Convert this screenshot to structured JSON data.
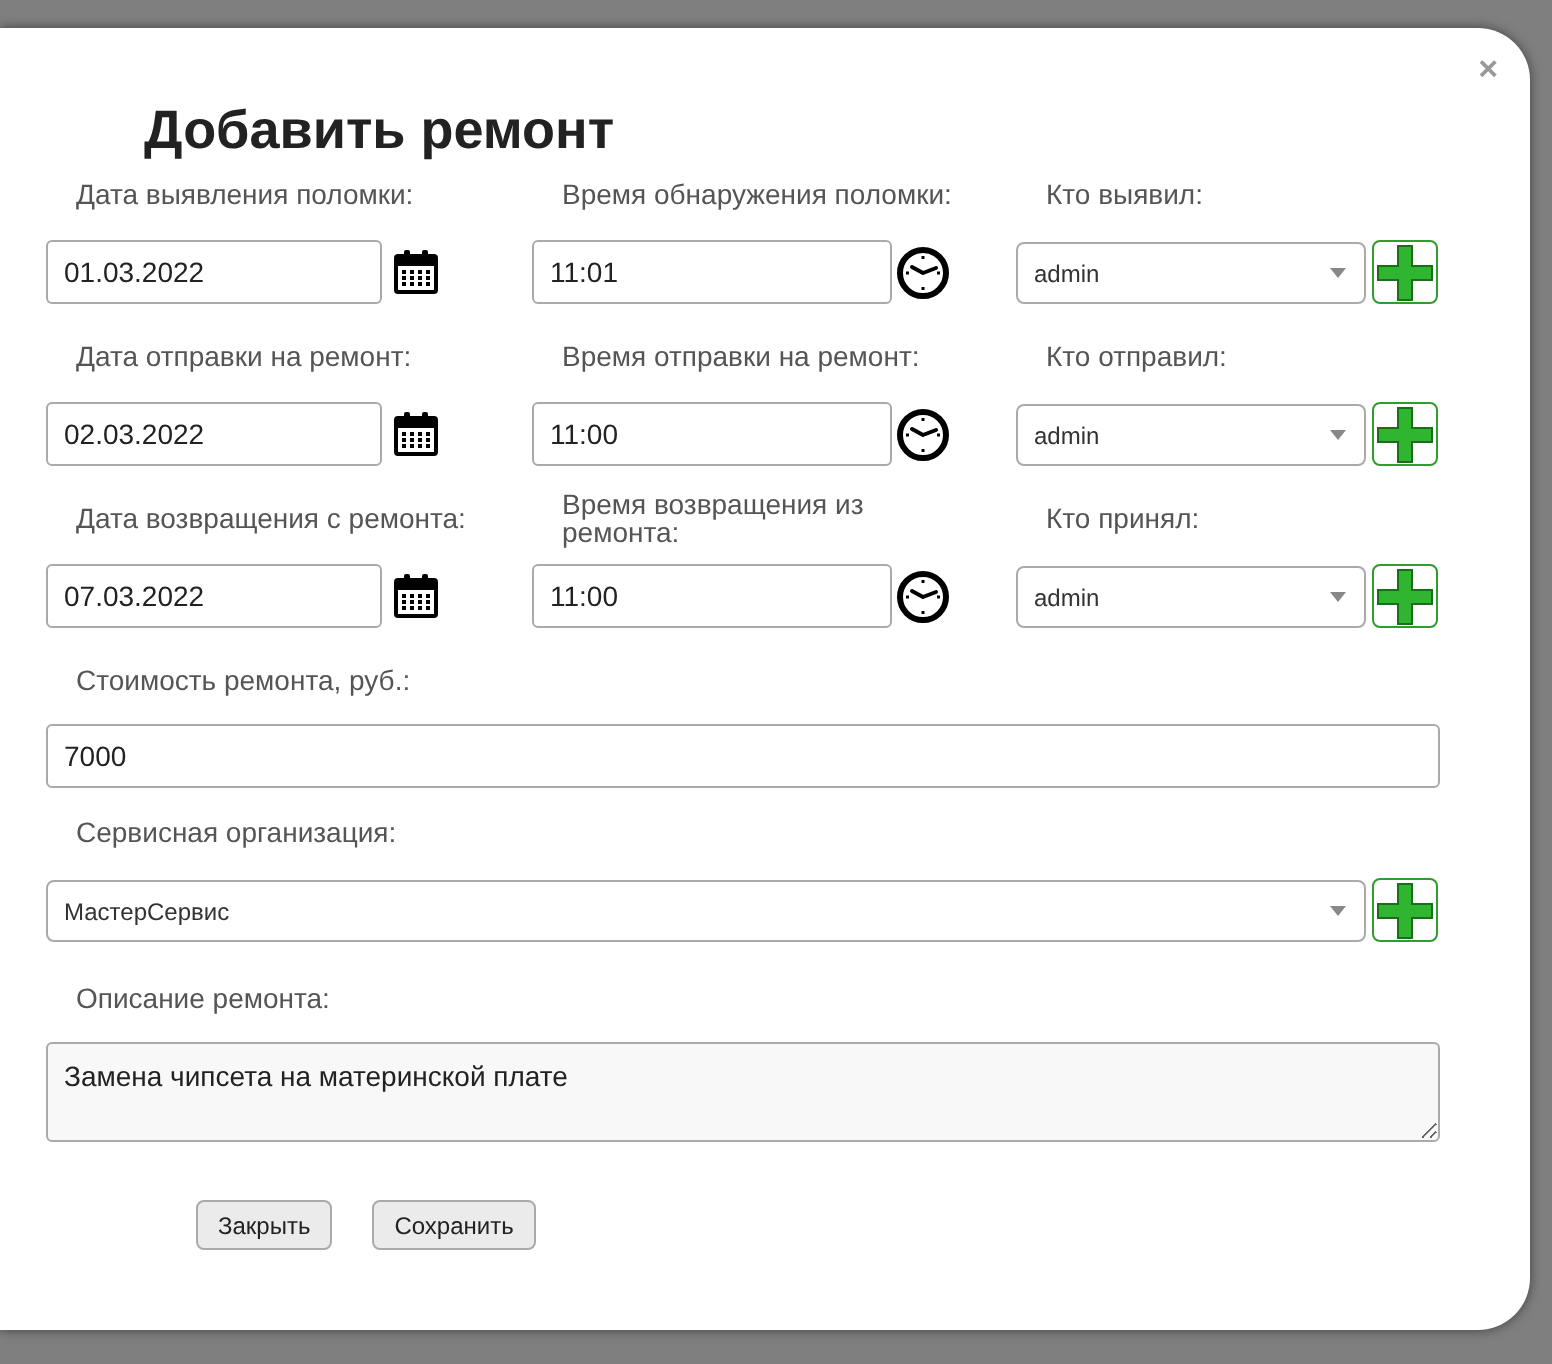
{
  "dialog": {
    "title": "Добавить ремонт",
    "close": "×"
  },
  "rows": [
    {
      "fields": [
        {
          "kind": "date",
          "label": "Дата выявления поломки:",
          "value": "01.03.2022"
        },
        {
          "kind": "time",
          "label": "Время обнаружения поломки:",
          "value": "11:01"
        },
        {
          "kind": "select",
          "label": "Кто выявил:",
          "value": "admin"
        }
      ]
    },
    {
      "fields": [
        {
          "kind": "date",
          "label": "Дата отправки на ремонт:",
          "value": "02.03.2022"
        },
        {
          "kind": "time",
          "label": "Время отправки на ремонт:",
          "value": "11:00"
        },
        {
          "kind": "select",
          "label": "Кто отправил:",
          "value": "admin"
        }
      ]
    },
    {
      "fields": [
        {
          "kind": "date",
          "label": "Дата возвращения с ремонта:",
          "value": "07.03.2022"
        },
        {
          "kind": "time",
          "label": "Время возвращения из ремонта:",
          "value": "11:00"
        },
        {
          "kind": "select",
          "label": "Кто принял:",
          "value": "admin"
        }
      ]
    }
  ],
  "cost": {
    "label": "Стоимость ремонта, руб.:",
    "value": "7000"
  },
  "organization": {
    "label": "Сервисная организация:",
    "value": "МастерСервис"
  },
  "description": {
    "label": "Описание ремонта:",
    "value": "Замена чипсета на материнской плате"
  },
  "buttons": [
    "Закрыть",
    "Сохранить"
  ]
}
